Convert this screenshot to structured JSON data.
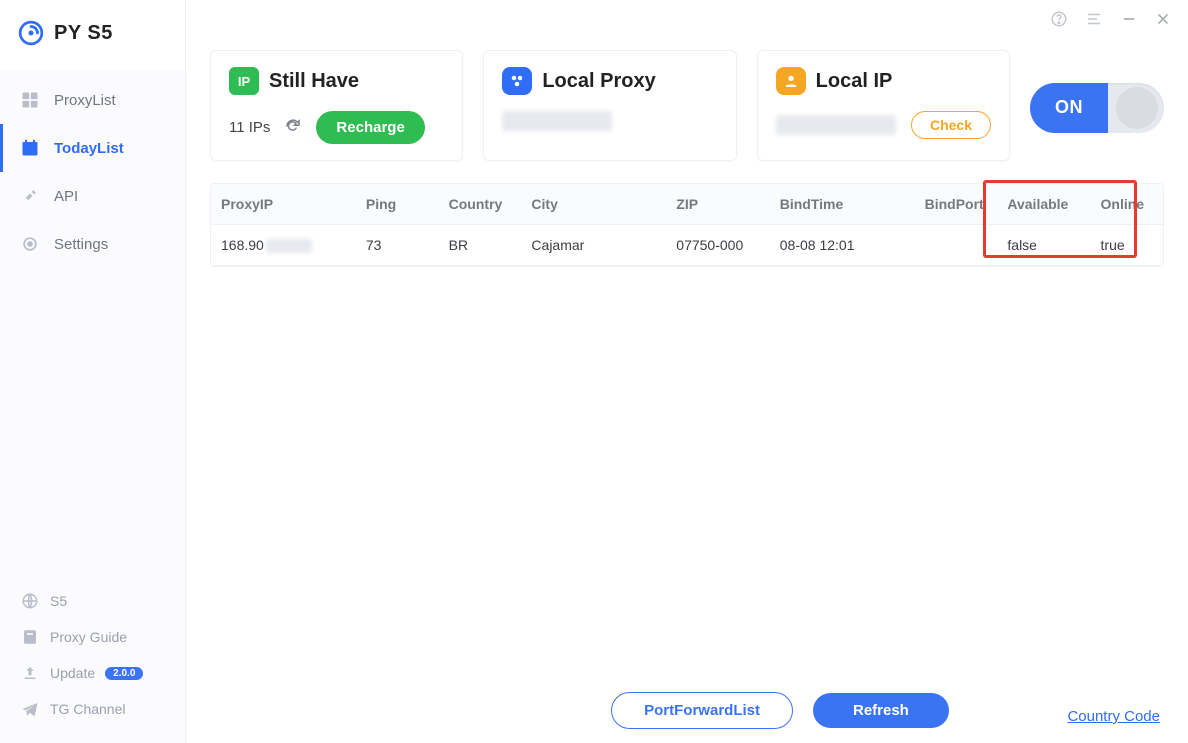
{
  "app": {
    "title": "PY S5"
  },
  "sidebar": {
    "nav": [
      {
        "label": "ProxyList"
      },
      {
        "label": "TodayList"
      },
      {
        "label": "API"
      },
      {
        "label": "Settings"
      }
    ],
    "bottom": [
      {
        "label": "S5"
      },
      {
        "label": "Proxy Guide"
      },
      {
        "label": "Update",
        "badge": "2.0.0"
      },
      {
        "label": "TG Channel"
      }
    ]
  },
  "cards": {
    "stillHave": {
      "title": "Still Have",
      "count": "11 IPs",
      "recharge": "Recharge"
    },
    "localProxy": {
      "title": "Local Proxy"
    },
    "localIP": {
      "title": "Local IP",
      "check": "Check"
    },
    "toggle": {
      "label": "ON"
    }
  },
  "table": {
    "headers": [
      "ProxyIP",
      "Ping",
      "Country",
      "City",
      "ZIP",
      "BindTime",
      "BindPort",
      "Available",
      "Online"
    ],
    "rows": [
      {
        "proxyip_prefix": "168.90",
        "ping": "73",
        "country": "BR",
        "city": "Cajamar",
        "zip": "07750-000",
        "bindtime": "08-08 12:01",
        "bindport": "",
        "available": "false",
        "online": "true"
      }
    ]
  },
  "footer": {
    "portForward": "PortForwardList",
    "refresh": "Refresh",
    "countryCode": "Country Code"
  }
}
